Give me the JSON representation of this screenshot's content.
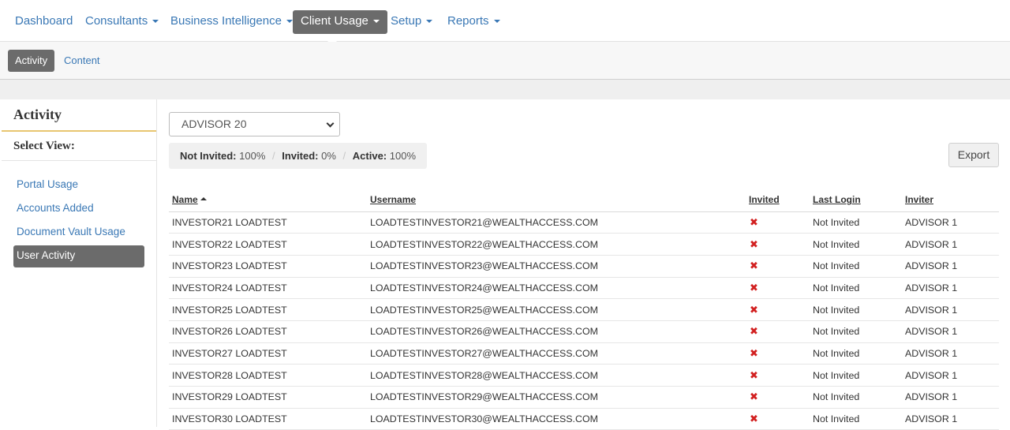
{
  "topnav": {
    "items": [
      {
        "label": "Dashboard",
        "dropdown": false
      },
      {
        "label": "Consultants",
        "dropdown": true
      },
      {
        "label": "Business Intelligence",
        "dropdown": true
      },
      {
        "label": "Client Usage",
        "dropdown": true,
        "active": true
      },
      {
        "label": "Setup",
        "dropdown": true
      },
      {
        "label": "Reports",
        "dropdown": true
      }
    ]
  },
  "subnav": {
    "items": [
      {
        "label": "Activity",
        "active": true
      },
      {
        "label": "Content"
      }
    ]
  },
  "sidebar": {
    "title": "Activity",
    "subtitle": "Select View:",
    "items": [
      {
        "label": "Portal Usage"
      },
      {
        "label": "Accounts Added"
      },
      {
        "label": "Document Vault Usage"
      },
      {
        "label": "User Activity",
        "active": true
      }
    ]
  },
  "filter": {
    "selected_advisor": "ADVISOR 20"
  },
  "stats": {
    "not_invited_label": "Not Invited:",
    "not_invited_value": "100%",
    "invited_label": "Invited:",
    "invited_value": "0%",
    "active_label": "Active:",
    "active_value": "100%",
    "separator": "/"
  },
  "export_label": "Export",
  "table": {
    "columns": [
      "Name",
      "Username",
      "Invited",
      "Last Login",
      "Inviter"
    ],
    "sort_column": "Name",
    "sort_direction": "asc",
    "rows": [
      {
        "name": "INVESTOR21 LOADTEST",
        "username": "LOADTESTINVESTOR21@WEALTHACCESS.COM",
        "invited": "✖",
        "last_login": "Not Invited",
        "inviter": "ADVISOR 1"
      },
      {
        "name": "INVESTOR22 LOADTEST",
        "username": "LOADTESTINVESTOR22@WEALTHACCESS.COM",
        "invited": "✖",
        "last_login": "Not Invited",
        "inviter": "ADVISOR 1"
      },
      {
        "name": "INVESTOR23 LOADTEST",
        "username": "LOADTESTINVESTOR23@WEALTHACCESS.COM",
        "invited": "✖",
        "last_login": "Not Invited",
        "inviter": "ADVISOR 1"
      },
      {
        "name": "INVESTOR24 LOADTEST",
        "username": "LOADTESTINVESTOR24@WEALTHACCESS.COM",
        "invited": "✖",
        "last_login": "Not Invited",
        "inviter": "ADVISOR 1"
      },
      {
        "name": "INVESTOR25 LOADTEST",
        "username": "LOADTESTINVESTOR25@WEALTHACCESS.COM",
        "invited": "✖",
        "last_login": "Not Invited",
        "inviter": "ADVISOR 1"
      },
      {
        "name": "INVESTOR26 LOADTEST",
        "username": "LOADTESTINVESTOR26@WEALTHACCESS.COM",
        "invited": "✖",
        "last_login": "Not Invited",
        "inviter": "ADVISOR 1"
      },
      {
        "name": "INVESTOR27 LOADTEST",
        "username": "LOADTESTINVESTOR27@WEALTHACCESS.COM",
        "invited": "✖",
        "last_login": "Not Invited",
        "inviter": "ADVISOR 1"
      },
      {
        "name": "INVESTOR28 LOADTEST",
        "username": "LOADTESTINVESTOR28@WEALTHACCESS.COM",
        "invited": "✖",
        "last_login": "Not Invited",
        "inviter": "ADVISOR 1"
      },
      {
        "name": "INVESTOR29 LOADTEST",
        "username": "LOADTESTINVESTOR29@WEALTHACCESS.COM",
        "invited": "✖",
        "last_login": "Not Invited",
        "inviter": "ADVISOR 1"
      },
      {
        "name": "INVESTOR30 LOADTEST",
        "username": "LOADTESTINVESTOR30@WEALTHACCESS.COM",
        "invited": "✖",
        "last_login": "Not Invited",
        "inviter": "ADVISOR 1"
      }
    ]
  },
  "colors": {
    "link": "#3a78b5",
    "active_bg": "#6b6b6b",
    "accent_underline": "#e8c670",
    "not_invited_icon": "#d22020"
  },
  "icons": {
    "dropdown": "caret-down-icon",
    "sort": "sort-up-icon",
    "not_invited": "x-mark-icon",
    "select": "chevron-down-icon"
  }
}
